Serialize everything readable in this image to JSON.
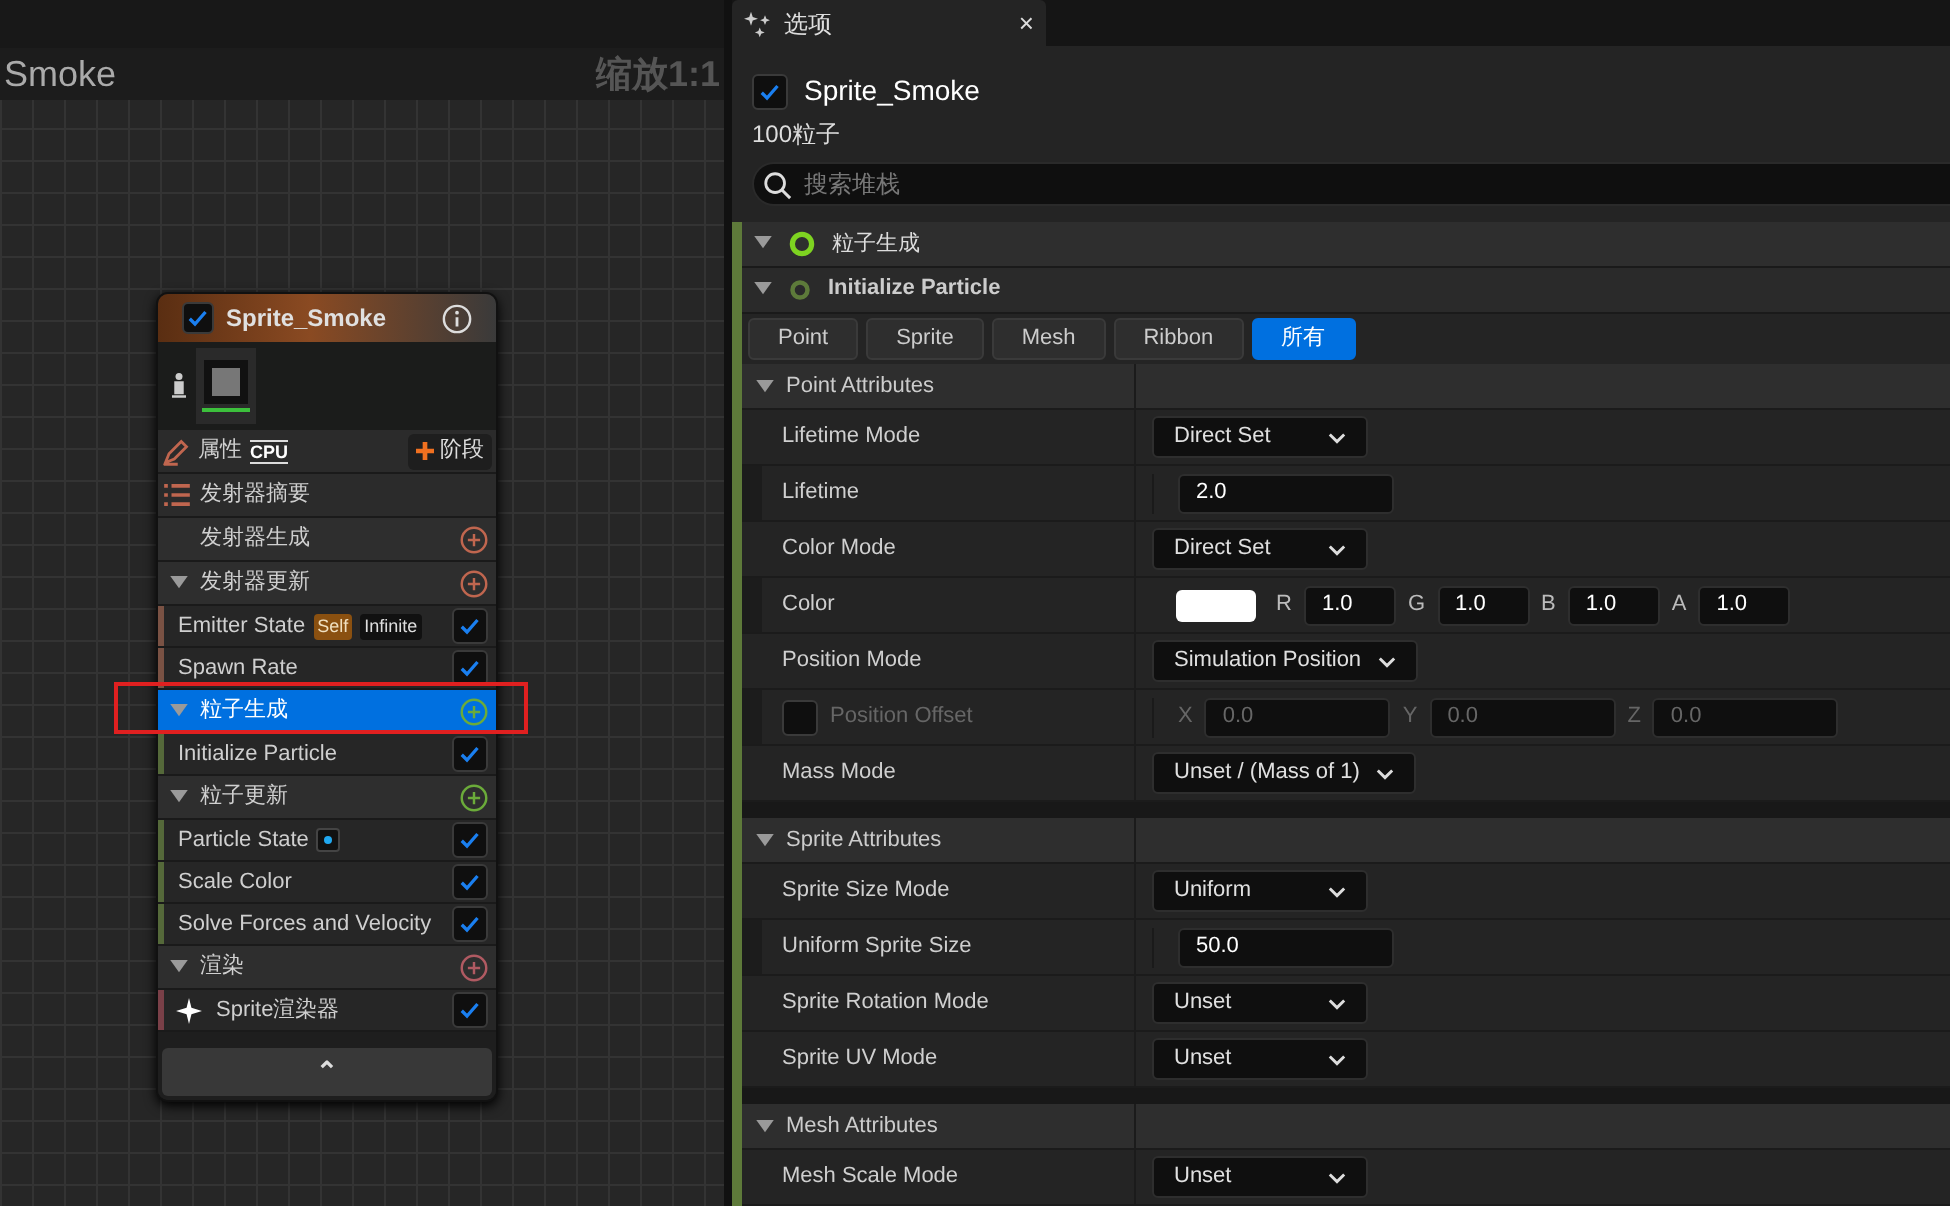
{
  "canvas": {
    "title": "Smoke",
    "zoom": "缩放1:1"
  },
  "node": {
    "title": "Sprite_Smoke",
    "enabled": true,
    "properties_label": "属性",
    "sim_target": "CPU",
    "add_stage": "阶段",
    "summary": "发射器摘要",
    "collapse": "⌃",
    "items": [
      {
        "kind": "stage",
        "label": "发射器生成",
        "color": "#c0664f",
        "has_toggle": false,
        "selected": false
      },
      {
        "kind": "stage",
        "label": "发射器更新",
        "color": "#c0664f",
        "has_toggle": true,
        "selected": false
      },
      {
        "kind": "module",
        "label": "Emitter State",
        "checked": true,
        "color": "#7a5244",
        "badges": [
          {
            "text": "Self",
            "kind": "accent"
          },
          {
            "text": "Infinite",
            "kind": "plain"
          }
        ]
      },
      {
        "kind": "module",
        "label": "Spawn Rate",
        "checked": true,
        "color": "#7a5244"
      },
      {
        "kind": "stage",
        "label": "粒子生成",
        "color": "#6bab3a",
        "has_toggle": true,
        "selected": true,
        "annotated": true
      },
      {
        "kind": "module",
        "label": "Initialize Particle",
        "checked": true,
        "color": "#55693a"
      },
      {
        "kind": "stage",
        "label": "粒子更新",
        "color": "#6bab3a",
        "has_toggle": true,
        "selected": false
      },
      {
        "kind": "module",
        "label": "Particle State",
        "checked": true,
        "color": "#55693a",
        "badges": [
          {
            "kind": "dot"
          }
        ]
      },
      {
        "kind": "module",
        "label": "Scale Color",
        "checked": true,
        "color": "#55693a"
      },
      {
        "kind": "module",
        "label": "Solve Forces and Velocity",
        "checked": true,
        "color": "#55693a"
      },
      {
        "kind": "stage",
        "label": "渲染",
        "color": "#b05a62",
        "has_toggle": true,
        "selected": false
      },
      {
        "kind": "renderer",
        "label": "Sprite渲染器",
        "checked": true,
        "color": "#7a4048"
      }
    ]
  },
  "panel": {
    "tab": {
      "title": "选项",
      "close": "×"
    },
    "emitter": {
      "name": "Sprite_Smoke",
      "enabled": true
    },
    "particle_count": "100粒子",
    "search": {
      "placeholder": "搜索堆栈"
    },
    "stage": {
      "label": "粒子生成"
    },
    "module": {
      "label": "Initialize Particle"
    },
    "filters": [
      {
        "label": "Point",
        "selected": false
      },
      {
        "label": "Sprite",
        "selected": false
      },
      {
        "label": "Mesh",
        "selected": false
      },
      {
        "label": "Ribbon",
        "selected": false
      },
      {
        "label": "所有",
        "selected": true
      }
    ],
    "sections": [
      {
        "title": "Point Attributes",
        "expanded": true,
        "rows": [
          {
            "kind": "dropdown",
            "label": "Lifetime Mode",
            "value": "Direct Set"
          },
          {
            "kind": "number",
            "label": "Lifetime",
            "value": "2.0"
          },
          {
            "kind": "dropdown",
            "label": "Color Mode",
            "value": "Direct Set"
          },
          {
            "kind": "color",
            "label": "Color",
            "color": "#ffffff",
            "channels": [
              {
                "axis": "R",
                "value": "1.0"
              },
              {
                "axis": "G",
                "value": "1.0"
              },
              {
                "axis": "B",
                "value": "1.0"
              },
              {
                "axis": "A",
                "value": "1.0"
              }
            ]
          },
          {
            "kind": "dropdown",
            "label": "Position Mode",
            "value": "Simulation Position"
          },
          {
            "kind": "vector",
            "label": "Position Offset",
            "checked": false,
            "channels": [
              {
                "axis": "X",
                "value": "0.0"
              },
              {
                "axis": "Y",
                "value": "0.0"
              },
              {
                "axis": "Z",
                "value": "0.0"
              }
            ]
          },
          {
            "kind": "dropdown",
            "label": "Mass Mode",
            "value": "Unset / (Mass of 1)"
          }
        ]
      },
      {
        "title": "Sprite Attributes",
        "expanded": true,
        "rows": [
          {
            "kind": "dropdown",
            "label": "Sprite Size Mode",
            "value": "Uniform"
          },
          {
            "kind": "number",
            "label": "Uniform Sprite Size",
            "value": "50.0"
          },
          {
            "kind": "dropdown",
            "label": "Sprite Rotation Mode",
            "value": "Unset"
          },
          {
            "kind": "dropdown",
            "label": "Sprite UV Mode",
            "value": "Unset"
          }
        ]
      },
      {
        "title": "Mesh Attributes",
        "expanded": true,
        "rows": [
          {
            "kind": "dropdown",
            "label": "Mesh Scale Mode",
            "value": "Unset"
          }
        ]
      }
    ]
  }
}
